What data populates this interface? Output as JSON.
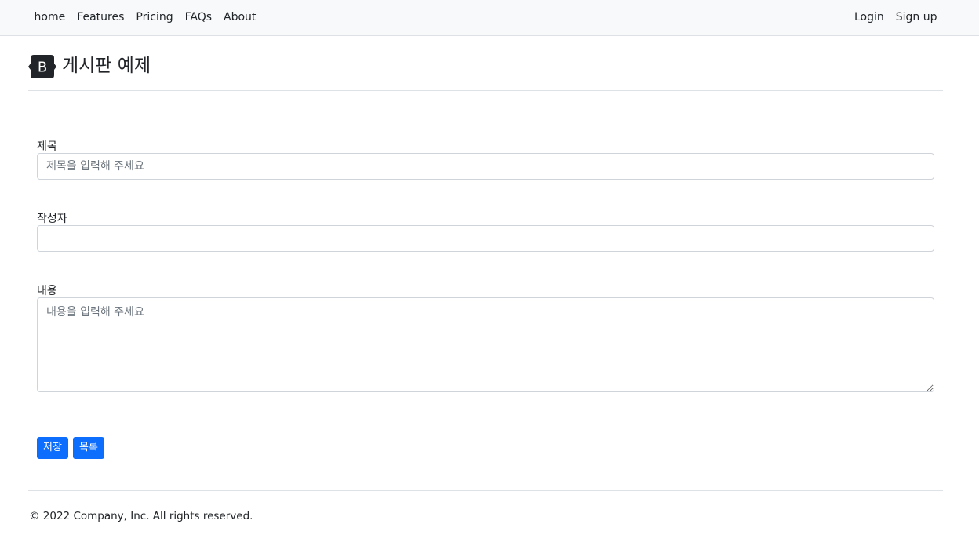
{
  "nav": {
    "left": [
      "home",
      "Features",
      "Pricing",
      "FAQs",
      "About"
    ],
    "right": [
      "Login",
      "Sign up"
    ]
  },
  "header": {
    "logo_letter": "B",
    "title": "게시판 예제"
  },
  "form": {
    "title_label": "제목",
    "title_placeholder": "제목을 입력해 주세요",
    "author_label": "작성자",
    "author_value": "",
    "content_label": "내용",
    "content_placeholder": "내용을 입력해 주세요"
  },
  "buttons": {
    "save": "저장",
    "list": "목록"
  },
  "footer": {
    "text": "© 2022 Company, Inc. All rights reserved."
  },
  "colors": {
    "primary": "#0d6efd",
    "navbar_bg": "#f8f9fa",
    "border": "#dee2e6",
    "logo_bg": "#212529"
  }
}
